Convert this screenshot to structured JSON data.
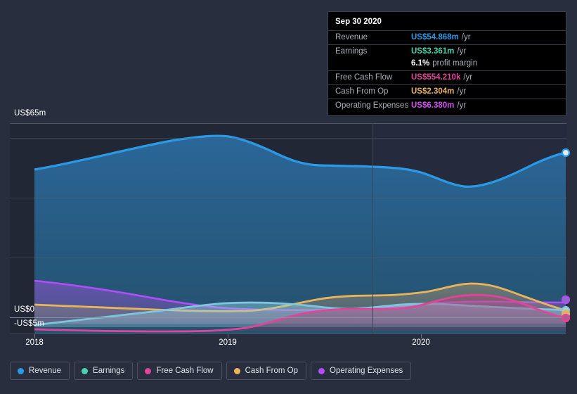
{
  "chart_data": {
    "type": "area",
    "title": "",
    "xlabel": "",
    "ylabel": "",
    "grid": true,
    "legend_position": "bottom",
    "x_ticks": [
      "2018",
      "2019",
      "2020"
    ],
    "y_ticks": [
      "US$65m",
      "US$0",
      "-US$5m"
    ],
    "ylim": [
      -5,
      65
    ],
    "currency": "US$",
    "forecast_divider_year": "2020 Q1",
    "series": [
      {
        "name": "Revenue",
        "color": "#2b9ae6",
        "values": [
          45.5,
          48.5,
          52.0,
          55.5,
          58.0,
          59.2,
          58.0,
          55.0,
          53.2,
          53.0,
          52.8,
          52.2,
          49.5,
          47.5,
          48.0,
          50.0,
          52.5,
          54.868
        ]
      },
      {
        "name": "Earnings",
        "color": "#4ad2b0",
        "values": [
          -4.6,
          -3.8,
          -3.0,
          -2.2,
          -1.4,
          -0.6,
          0.1,
          0.6,
          0.8,
          0.9,
          0.7,
          0.4,
          0.8,
          1.3,
          1.6,
          1.5,
          2.4,
          3.361
        ]
      },
      {
        "name": "Free Cash Flow",
        "color": "#e0459a",
        "values": [
          -5.3,
          -5.5,
          -5.6,
          -5.6,
          -5.5,
          -5.2,
          -4.4,
          -3.0,
          -1.6,
          -1.0,
          -1.0,
          -1.1,
          -0.9,
          0.1,
          1.6,
          2.3,
          1.7,
          0.554
        ]
      },
      {
        "name": "Cash From Op",
        "color": "#e8b45c",
        "values": [
          0.5,
          0.4,
          0.3,
          0.2,
          0.1,
          0.1,
          0.3,
          1.2,
          2.0,
          2.1,
          2.1,
          2.2,
          2.6,
          3.4,
          4.2,
          4.0,
          3.0,
          2.304
        ]
      },
      {
        "name": "Operating Expenses",
        "color": "#b14dfa",
        "values": [
          6.6,
          6.1,
          5.4,
          4.6,
          3.8,
          3.0,
          2.3,
          1.9,
          1.8,
          1.8,
          1.9,
          2.0,
          2.2,
          2.3,
          2.4,
          2.4,
          2.4,
          6.38
        ]
      }
    ],
    "end_markers": [
      {
        "name": "Revenue",
        "color": "#2b9ae6"
      },
      {
        "name": "Operating Expenses",
        "color": "#b14dfa"
      },
      {
        "name": "Earnings",
        "color": "#4ad2b0"
      },
      {
        "name": "Cash From Op",
        "color": "#e8b45c"
      },
      {
        "name": "Free Cash Flow",
        "color": "#e0459a"
      }
    ]
  },
  "tooltip": {
    "date": "Sep 30 2020",
    "rows": [
      {
        "label": "Revenue",
        "value": "US$54.868m",
        "unit": "/yr",
        "color": "#2b9ae6"
      },
      {
        "label": "Earnings",
        "value": "US$3.361m",
        "unit": "/yr",
        "color": "#4ad2b0"
      },
      {
        "label": "Free Cash Flow",
        "value": "US$554.210k",
        "unit": "/yr",
        "color": "#e0459a"
      },
      {
        "label": "Cash From Op",
        "value": "US$2.304m",
        "unit": "/yr",
        "color": "#e8b45c"
      },
      {
        "label": "Operating Expenses",
        "value": "US$6.380m",
        "unit": "/yr",
        "color": "#b14dfa"
      }
    ],
    "profit_margin_value": "6.1%",
    "profit_margin_text": "profit margin"
  },
  "legend": {
    "items": [
      {
        "label": "Revenue",
        "color": "#2b9ae6"
      },
      {
        "label": "Earnings",
        "color": "#4ad2b0"
      },
      {
        "label": "Free Cash Flow",
        "color": "#e0459a"
      },
      {
        "label": "Cash From Op",
        "color": "#e8b45c"
      },
      {
        "label": "Operating Expenses",
        "color": "#b14dfa"
      }
    ]
  },
  "axis": {
    "y_top": "US$65m",
    "y_zero": "US$0",
    "y_negative": "-US$5m",
    "x": [
      {
        "label": "2018",
        "x": 49
      },
      {
        "label": "2019",
        "x": 324
      },
      {
        "label": "2020",
        "x": 599
      }
    ]
  }
}
